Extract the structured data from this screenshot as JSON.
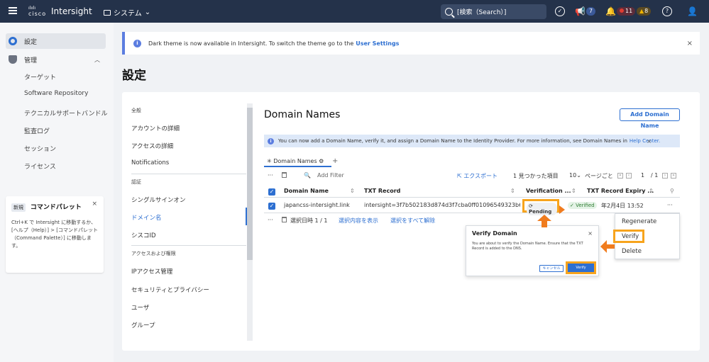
{
  "topbar": {
    "logo_text": "cisco",
    "app_name": "Intersight",
    "system_menu": "システム",
    "search_placeholder": "[検索（Search）]",
    "notifications_count": "7",
    "critical_count": "11",
    "warning_count": "8"
  },
  "sidebar": {
    "settings_label": "設定",
    "admin_label": "管理",
    "sub_items": [
      "ターゲット",
      "Software Repository",
      "テクニカルサポートバンドル",
      "監査ログ",
      "セッション",
      "ライセンス"
    ],
    "palette": {
      "badge": "新規",
      "title": "コマンドパレット",
      "body": "Ctrl+K で Intersight に移動するか、[ヘルプ（Help）] > [コマンドパレット（Command Palette）] に移動します。"
    }
  },
  "banner": {
    "text": "Dark theme is now available in Intersight. To switch the theme go to the",
    "link": "User Settings"
  },
  "page_title": "設定",
  "settings_nav": {
    "section_general": "全般",
    "general_items": [
      "アカウントの詳細",
      "アクセスの詳細",
      "Notifications"
    ],
    "section_auth": "認証",
    "auth_items": [
      "シングルサインオン",
      "ドメイン名",
      "シスコID"
    ],
    "section_access": "アクセスおよび権限",
    "access_items": [
      "IPアクセス管理",
      "セキュリティとプライバシー",
      "ユーザ",
      "グループ"
    ]
  },
  "domain_names": {
    "title": "Domain Names",
    "add_button": "Add Domain Name",
    "info_text": "You can now add a Domain Name, verify it, and assign a Domain Name to the Identity Provider. For more information, see Domain Names in",
    "info_link": "Help Center.",
    "tab_label": "Domain Names",
    "add_filter": "Add Filter",
    "export": "エクスポート",
    "found": "1 見つかった項目",
    "per_page": "10",
    "per_page_label": "ページごと",
    "page_current": "1",
    "page_total": "/ 1",
    "columns": [
      "Domain Name",
      "TXT Record",
      "Verification ...",
      "TXT Record Expiry ..."
    ],
    "row": {
      "domain": "japancss-intersight.link",
      "txt": "intersight=3f7b502183d874d3f7cba0ff01096549323b65",
      "status_pending": "Pending",
      "status_verified": "Verified",
      "expiry": "年2月4日 13:52"
    },
    "footer": {
      "selected": "選択日時 1 / 1",
      "show_selected": "選択内容を表示",
      "deselect_all": "選択をすべて解除"
    }
  },
  "row_menu": {
    "items": [
      "Regenerate",
      "Verify",
      "Delete"
    ]
  },
  "verify_modal": {
    "title": "Verify Domain",
    "body": "You are about to verify the Domain Name. Ensure that the TXT Record is added to the DNS.",
    "cancel": "キャンセル",
    "verify": "Verify"
  },
  "colors": {
    "topbar": "#24324a",
    "accent": "#2d6fd1",
    "highlight": "#f7a41d"
  }
}
